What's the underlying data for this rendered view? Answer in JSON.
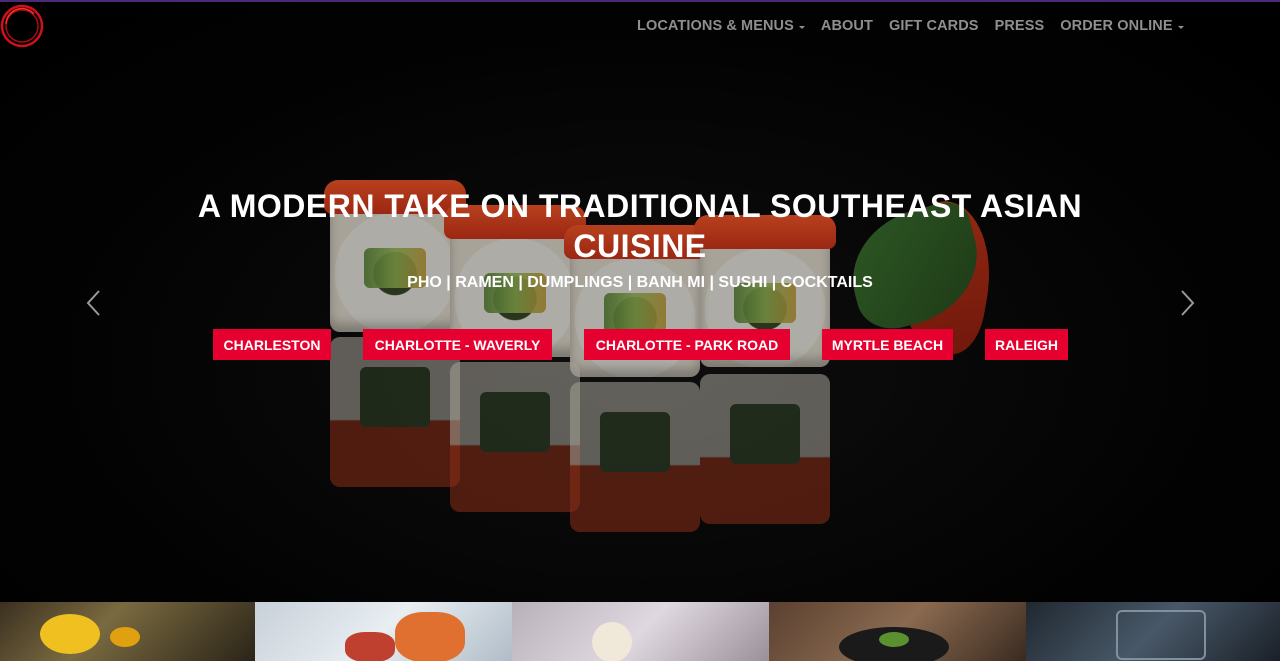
{
  "nav": {
    "items": [
      {
        "label": "LOCATIONS & MENUS",
        "dropdown": true
      },
      {
        "label": "ABOUT",
        "dropdown": false
      },
      {
        "label": "GIFT CARDS",
        "dropdown": false
      },
      {
        "label": "PRESS",
        "dropdown": false
      },
      {
        "label": "ORDER ONLINE",
        "dropdown": true
      }
    ]
  },
  "hero": {
    "headline": "A MODERN TAKE ON TRADITIONAL SOUTHEAST ASIAN CUISINE",
    "subhead": "PHO | RAMEN | DUMPLINGS | BANH MI | SUSHI | COCKTAILS",
    "locations": [
      "CHARLESTON",
      "CHARLOTTE - WAVERLY",
      "CHARLOTTE - PARK ROAD",
      "MYRTLE BEACH",
      "RALEIGH"
    ],
    "prev_icon": "chevron-left-icon",
    "next_icon": "chevron-right-icon"
  },
  "colors": {
    "accent": "#e5002f",
    "nav_text": "#8f8f8f",
    "logo_ring": "#d0101a",
    "top_line": "#4a2a78"
  }
}
